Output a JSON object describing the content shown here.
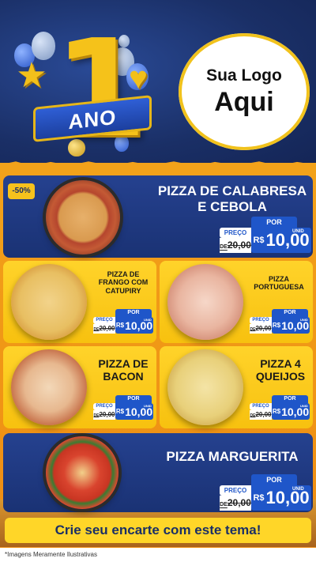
{
  "header": {
    "anniversary_number": "1",
    "anniversary_label": "ANO",
    "logo_line1": "Sua Logo",
    "logo_line2": "Aqui"
  },
  "discount_badge": "-50%",
  "products": [
    {
      "name_line1": "PIZZA DE CALABRESA",
      "name_line2": "E CEBOLA",
      "price_label": "PREÇO",
      "old_price_prefix": "DE",
      "old_price": "20,00",
      "por": "POR",
      "currency": "R$",
      "price": "10,00",
      "unit": "UNID"
    },
    {
      "name_line1": "PIZZA DE",
      "name_line2": "FRANGO COM",
      "name_line3": "CATUPIRY",
      "price_label": "PREÇO",
      "old_price_prefix": "DE",
      "old_price": "20,00",
      "por": "POR",
      "currency": "R$",
      "price": "10,00",
      "unit": "UNID"
    },
    {
      "name_line1": "PIZZA",
      "name_line2": "PORTUGUESA",
      "price_label": "PREÇO",
      "old_price_prefix": "DE",
      "old_price": "20,00",
      "por": "POR",
      "currency": "R$",
      "price": "10,00",
      "unit": "UNID"
    },
    {
      "name_line1": "PIZZA DE",
      "name_line2": "BACON",
      "price_label": "PREÇO",
      "old_price_prefix": "DE",
      "old_price": "20,00",
      "por": "POR",
      "currency": "R$",
      "price": "10,00",
      "unit": "UNID"
    },
    {
      "name_line1": "PIZZA 4",
      "name_line2": "QUEIJOS",
      "price_label": "PREÇO",
      "old_price_prefix": "DE",
      "old_price": "20,00",
      "por": "POR",
      "currency": "R$",
      "price": "10,00",
      "unit": "UNID"
    },
    {
      "name_line1": "PIZZA MARGUERITA",
      "price_label": "PREÇO",
      "old_price_prefix": "DE",
      "old_price": "20,00",
      "por": "POR",
      "currency": "R$",
      "price": "10,00",
      "unit": "UNID"
    }
  ],
  "cta": "Crie seu encarte com este tema!",
  "footer_note": "*Imagens Meramente Ilustrativas",
  "colors": {
    "navy": "#1a2f66",
    "orange": "#f2a21a",
    "yellow": "#ffd32a",
    "price_blue": "#1f56c9",
    "gold": "#f5c21a"
  }
}
